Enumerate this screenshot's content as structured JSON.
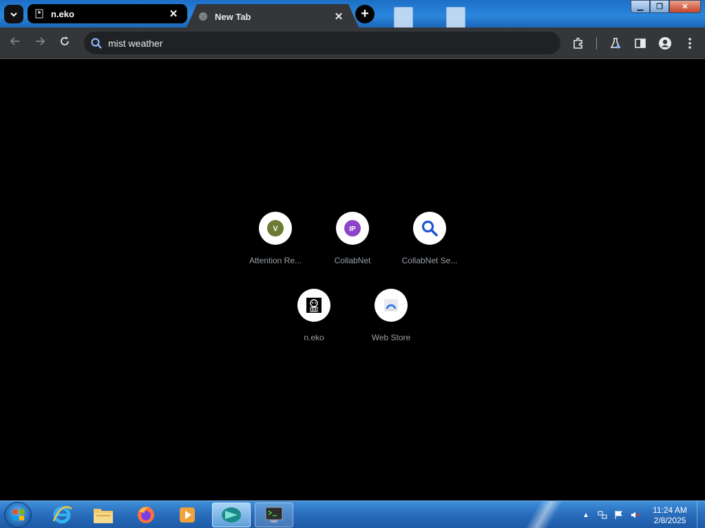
{
  "tabs": [
    {
      "title": "n.eko",
      "icon": "neko-favicon-icon",
      "active": false
    },
    {
      "title": "New Tab",
      "icon": "globe-icon",
      "active": true
    }
  ],
  "omnibox": {
    "value": "mist weather",
    "placeholder": ""
  },
  "shortcuts": [
    {
      "title": "Attention Re...",
      "icon_letter": "V",
      "color": "#6b7a34"
    },
    {
      "title": "CollabNet",
      "icon_letter": "IP",
      "color": "#8e44c9"
    },
    {
      "title": "CollabNet Se...",
      "icon": "magnifier-icon",
      "color": "#1a56d6"
    },
    {
      "title": "n.eko",
      "icon": "neko-icon"
    },
    {
      "title": "Web Store",
      "icon": "web-store-icon",
      "color": "#3b78e7"
    }
  ],
  "taskbar": {
    "apps": [
      "internet-explorer-icon",
      "file-explorer-icon",
      "firefox-icon",
      "media-player-icon",
      "browser-app-icon",
      "terminal-app-icon"
    ]
  },
  "clock": {
    "time": "11:24 AM",
    "date": "2/8/2025"
  },
  "colors": {
    "toolbar": "#35363a",
    "omnibox": "#202124",
    "page_bg": "#000000",
    "taskbar": "#2a6fbe"
  }
}
